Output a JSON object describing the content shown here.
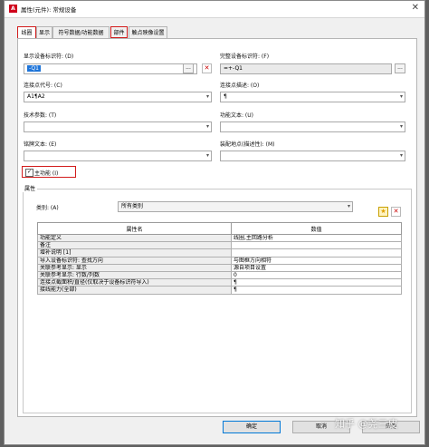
{
  "window": {
    "title": "属性(元件): 常规设备",
    "app_icon": "A"
  },
  "tabs": [
    "线圈",
    "显示",
    "符号数据/功能数据",
    "部件",
    "触点映像设置"
  ],
  "fields": {
    "display_id_label": "显示设备标识符: (D)",
    "display_id_value": "-Q1",
    "full_id_label": "完整设备标识符: (F)",
    "full_id_value": "=+-Q1",
    "conn_code_label": "连接点代号: (C)",
    "conn_code_value": "A1¶A2",
    "conn_desc_label": "连接点描述: (O)",
    "conn_desc_value": "¶",
    "tech_param_label": "技术参数: (T)",
    "func_text_label": "功能文本: (U)",
    "nameplate_label": "铭牌文本: (E)",
    "install_label": "装配地点(描述性): (M)",
    "main_func_label": "主功能 (I)",
    "more_button": "..."
  },
  "properties": {
    "group_title": "属性",
    "category_label": "类别: (A)",
    "category_value": "所有类别",
    "col_name": "属性名",
    "col_value": "数值",
    "rows": [
      {
        "name": "功能定义",
        "value": "线圈,主回路分析"
      },
      {
        "name": "备注",
        "value": ""
      },
      {
        "name": "增补说明 [1]",
        "value": ""
      },
      {
        "name": "导入设备标识符: 查找方向",
        "value": "与图框方向相符"
      },
      {
        "name": "关联参考显示: 显示",
        "value": "源自项目设置"
      },
      {
        "name": "关联参考显示: 行数/列数",
        "value": "0"
      },
      {
        "name": "连接点截面积/直径(仅取决于设备标识符导入)",
        "value": "¶"
      },
      {
        "name": "接线能力(全部)",
        "value": "¶"
      }
    ]
  },
  "buttons": {
    "ok": "确定",
    "cancel": "取消",
    "apply": "应用"
  },
  "watermark": "知乎 @尧三皮",
  "colors": {
    "highlight_box": "#d21c1c",
    "selection": "#1e74d8"
  }
}
